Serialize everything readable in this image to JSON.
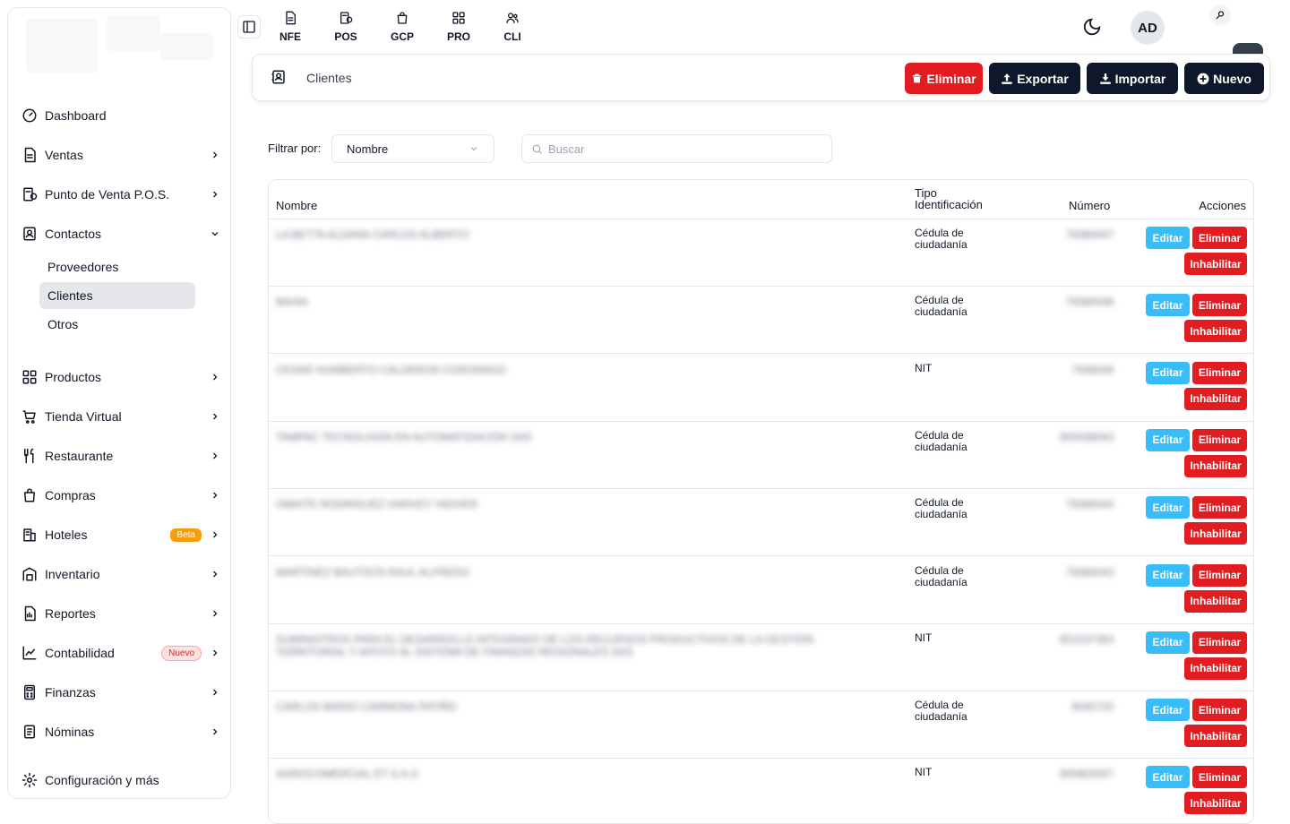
{
  "topbar": {
    "apps": [
      {
        "label": "NFE",
        "icon": "document-icon"
      },
      {
        "label": "POS",
        "icon": "receipt-icon"
      },
      {
        "label": "GCP",
        "icon": "shopping-bag-icon"
      },
      {
        "label": "PRO",
        "icon": "grid-icon"
      },
      {
        "label": "CLI",
        "icon": "users-icon"
      }
    ],
    "avatar": "AD"
  },
  "sidebar": {
    "items": [
      {
        "label": "Dashboard",
        "icon": "gauge-icon"
      },
      {
        "label": "Ventas",
        "icon": "document-icon"
      },
      {
        "label": "Punto de Venta P.O.S.",
        "icon": "receipt-icon"
      },
      {
        "label": "Contactos",
        "icon": "contacts-icon"
      },
      {
        "label": "Productos",
        "icon": "grid-icon"
      },
      {
        "label": "Tienda Virtual",
        "icon": "cart-icon"
      },
      {
        "label": "Restaurante",
        "icon": "utensils-icon"
      },
      {
        "label": "Compras",
        "icon": "shopping-bag-icon"
      },
      {
        "label": "Hoteles",
        "icon": "hotel-icon",
        "badge": "Beta"
      },
      {
        "label": "Inventario",
        "icon": "warehouse-icon"
      },
      {
        "label": "Reportes",
        "icon": "report-icon"
      },
      {
        "label": "Contabilidad",
        "icon": "chart-icon",
        "badge": "Nuevo"
      },
      {
        "label": "Finanzas",
        "icon": "calculator-icon"
      },
      {
        "label": "Nóminas",
        "icon": "payroll-icon"
      }
    ],
    "contactos_sub": [
      "Proveedores",
      "Clientes",
      "Otros"
    ],
    "config": "Configuración y más"
  },
  "page": {
    "title": "Clientes",
    "buttons": {
      "delete": "Eliminar",
      "export": "Exportar",
      "import": "Importar",
      "new": "Nuevo"
    },
    "colors": {
      "danger": "#e11d22",
      "dark": "#0f172a",
      "edit": "#38bdf8"
    }
  },
  "filter": {
    "label": "Filtrar por:",
    "selected": "Nombre",
    "search_placeholder": "Buscar"
  },
  "table": {
    "headers": {
      "name": "Nombre",
      "tipo": "Tipo Identificación",
      "numero": "Número",
      "acciones": "Acciones"
    },
    "actions": {
      "edit": "Editar",
      "delete": "Eliminar",
      "disable": "Inhabilitar"
    },
    "rows": [
      {
        "name": "LA BETTA ALDANA CARLOS ALBERTO",
        "tipo": "Cédula de ciudadanía",
        "numero": "79380047"
      },
      {
        "name": "BAHIA",
        "tipo": "Cédula de ciudadanía",
        "numero": "79380048"
      },
      {
        "name": "CESAR HUMBERTO CALDERON CORONADO",
        "tipo": "NIT",
        "numero": "7938049"
      },
      {
        "name": "TAMPAC TECNOLOGÍA EN AUTOMATIZACIÓN SAS",
        "tipo": "Cédula de ciudadanía",
        "numero": "900438043"
      },
      {
        "name": "OMAITE RODRIGUEZ HARVEY YADVER",
        "tipo": "Cédula de ciudadanía",
        "numero": "79380044"
      },
      {
        "name": "MARTINEZ BAUTISTA RAUL ALFREDO",
        "tipo": "Cédula de ciudadanía",
        "numero": "79380043"
      },
      {
        "name": "SUMINISTROS PARA EL DESARROLLO INTEGRADO DE LOS RECURSOS PRODUCTIVOS DE LA GESTIÓN TERRITORIAL Y APOYO AL SISTEMA DE FINANZAS REGIONALES SAS",
        "tipo": "NIT",
        "numero": "901537383"
      },
      {
        "name": "CARLOS MARIO CARMONA PATIÑO",
        "tipo": "Cédula de ciudadanía",
        "numero": "9045720"
      },
      {
        "name": "AGROCOMERCIAL ET S.A.S",
        "tipo": "NIT",
        "numero": "900803007"
      }
    ]
  }
}
